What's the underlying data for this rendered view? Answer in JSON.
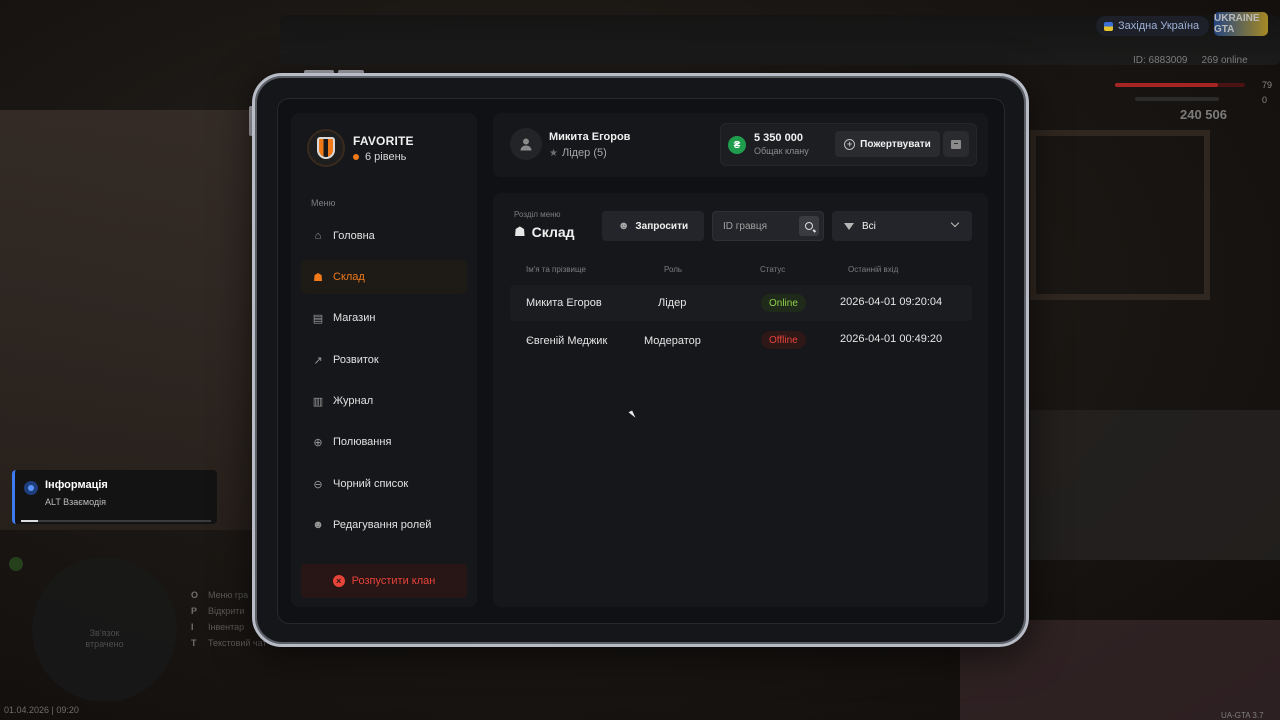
{
  "hud": {
    "region": "Західна Україна",
    "logo": "UKRAINE GTA",
    "id_label": "ID: 6883009",
    "online": "269 online",
    "hp": "79",
    "armor": "0",
    "hp_fraction": 0.79,
    "money": "240 506",
    "version": "UA-GTA 3.7",
    "datetime": "01.04.2026 | 09:20"
  },
  "notification": {
    "title": "Інформація",
    "text": "ALT Взаємодія",
    "progress": 0.09
  },
  "minimap": {
    "text_line1": "Зв'язок",
    "text_line2": "втрачено"
  },
  "hints": [
    {
      "key": "O",
      "label": "Меню гра"
    },
    {
      "key": "P",
      "label": "Відкрити"
    },
    {
      "key": "I",
      "label": "Інвентар"
    },
    {
      "key": "T",
      "label": "Текстовий чат"
    }
  ],
  "clan": {
    "name": "FAVORITE",
    "level": "6 рівень"
  },
  "sidebar": {
    "menu_caption": "Меню",
    "items": [
      {
        "label": "Головна",
        "icon": "home-icon",
        "active": false
      },
      {
        "label": "Склад",
        "icon": "users-icon",
        "active": true
      },
      {
        "label": "Магазин",
        "icon": "shop-icon",
        "active": false
      },
      {
        "label": "Розвиток",
        "icon": "chart-icon",
        "active": false
      },
      {
        "label": "Журнал",
        "icon": "book-icon",
        "active": false
      },
      {
        "label": "Полювання",
        "icon": "crosshair-icon",
        "active": false
      },
      {
        "label": "Чорний список",
        "icon": "ban-icon",
        "active": false
      },
      {
        "label": "Редагування ролей",
        "icon": "user-edit-icon",
        "active": false
      }
    ],
    "danger_label": "Розпустити клан"
  },
  "header": {
    "user_name": "Микита Егоров",
    "user_role": "Лідер (5)",
    "funds_amount": "5 350 000",
    "funds_label": "Общак клану",
    "donate_label": "Пожертвувати",
    "currency_symbol": "₴"
  },
  "section": {
    "caption": "Розділ меню",
    "title": "Склад",
    "invite_label": "Запросити",
    "search_placeholder": "ID гравця",
    "filter_value": "Всі"
  },
  "table": {
    "columns": [
      "Ім'я та прізвище",
      "Роль",
      "Статус",
      "Останній вхід"
    ],
    "rows": [
      {
        "name": "Микита Егоров",
        "role": "Лідер",
        "status": "Online",
        "last": "2026-04-01 09:20:04"
      },
      {
        "name": "Євгеній Меджик",
        "role": "Модератор",
        "status": "Offline",
        "last": "2026-04-01 00:49:20"
      }
    ]
  },
  "colors": {
    "accent": "#f07a1a",
    "online": "#8fd04a",
    "offline": "#e8443a",
    "funds": "#1f9d4d"
  }
}
